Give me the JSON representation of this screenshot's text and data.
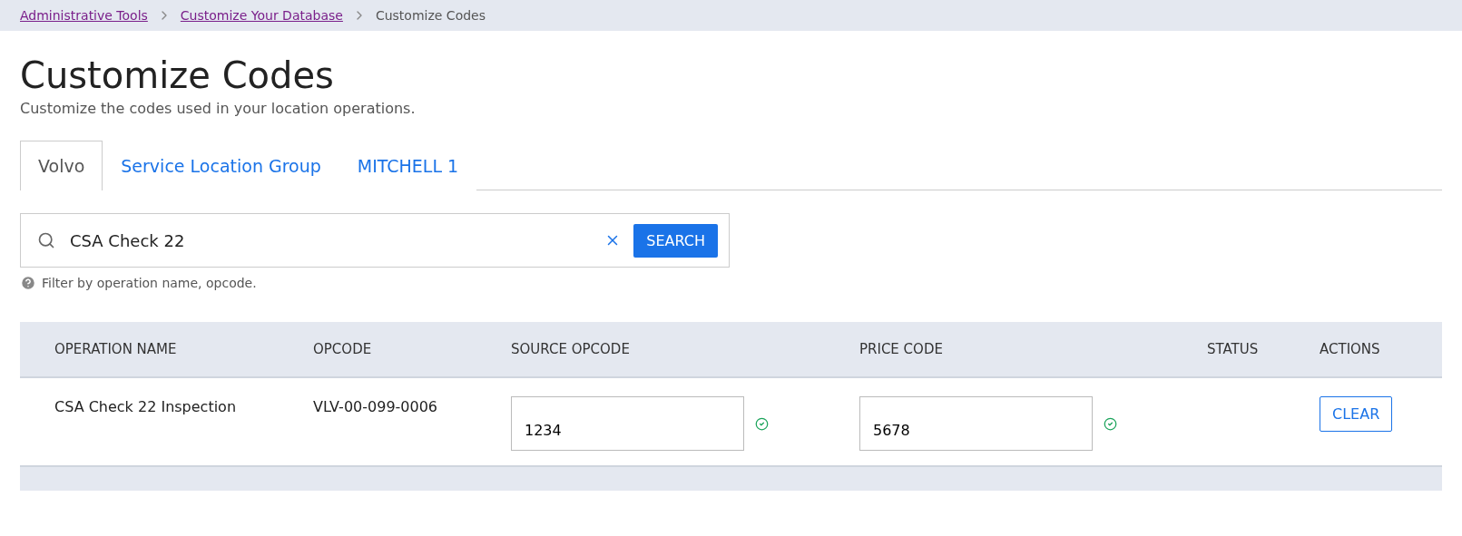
{
  "breadcrumb": [
    {
      "label": "Administrative Tools",
      "link": true
    },
    {
      "label": "Customize Your Database",
      "link": true
    },
    {
      "label": "Customize Codes",
      "link": false
    }
  ],
  "title": "Customize Codes",
  "subtitle": "Customize the codes used in your location operations.",
  "tabs": [
    {
      "label": "Volvo",
      "selected": true
    },
    {
      "label": "Service Location Group",
      "selected": false
    },
    {
      "label": "MITCHELL 1",
      "selected": false
    }
  ],
  "search": {
    "value": "CSA Check 22",
    "button": "SEARCH",
    "hint": "Filter by operation name, opcode."
  },
  "table": {
    "columns": [
      "OPERATION NAME",
      "OPCODE",
      "SOURCE OPCODE",
      "PRICE CODE",
      "STATUS",
      "ACTIONS"
    ],
    "rows": [
      {
        "operation_name": "CSA Check 22 Inspection",
        "opcode": "VLV-00-099-0006",
        "source_opcode": {
          "value": "1234",
          "valid": true
        },
        "price_code": {
          "value": "5678",
          "valid": true
        },
        "action": "CLEAR"
      }
    ]
  }
}
